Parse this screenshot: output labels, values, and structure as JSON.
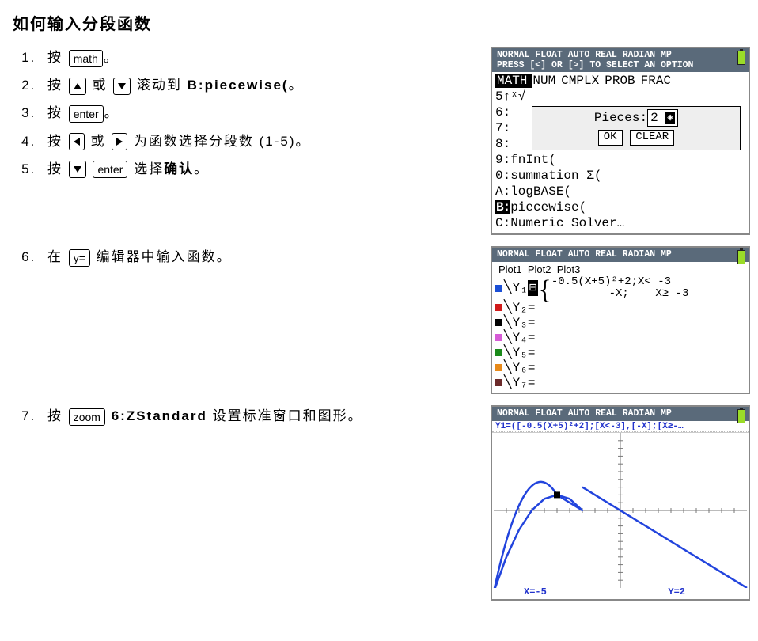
{
  "title": "如何输入分段函数",
  "keys": {
    "math": "math",
    "enter": "enter",
    "yequals": "y=",
    "zoom": "zoom"
  },
  "steps": {
    "s1a": "按 ",
    "s1b": "。",
    "s2a": "按 ",
    "s2b": " 或 ",
    "s2c": " 滚动到 ",
    "s2bold": "B:piecewise(",
    "s2d": "。",
    "s3a": "按 ",
    "s3b": "。",
    "s4a": "按 ",
    "s4b": " 或 ",
    "s4c": " 为函数选择分段数 (1-5)。",
    "s5a": "按 ",
    "s5b": " ",
    "s5c": " 选择",
    "s5bold": "确认",
    "s5d": "。",
    "s6a": "在 ",
    "s6b": " 编辑器中输入函数。",
    "s7a": "按 ",
    "s7b": " ",
    "s7bold": "6:ZStandard",
    "s7c": " 设置标准窗口和图形。"
  },
  "screen1": {
    "hdr1": "NORMAL FLOAT AUTO REAL RADIAN MP",
    "hdr2": "PRESS [<] OR [>] TO SELECT AN OPTION",
    "tabs": {
      "sel": "MATH",
      "t2": "NUM",
      "t3": "CMPLX",
      "t4": "PROB",
      "t5": "FRAC"
    },
    "l5": "5↑ˣ√",
    "l6": "6:",
    "l7": "7:",
    "l8": "8:",
    "popup_label": "Pieces:",
    "popup_val": "2",
    "ok": "OK",
    "clear": "CLEAR",
    "l9": "9:fnInt(",
    "l0": "0:summation Σ(",
    "lA": "A:logBASE(",
    "lB_pre": "B:",
    "lB_txt": "piecewise(",
    "lC": "C:Numeric Solver…"
  },
  "screen2": {
    "hdr1": "NORMAL FLOAT AUTO REAL RADIAN MP",
    "plots": {
      "p1": "Plot1",
      "p2": "Plot2",
      "p3": "Plot3"
    },
    "y1label": "Y₁",
    "piece1a": "-0.5(X+5)²+2;",
    "piece1b": "X< -3",
    "piece2a": "-X;",
    "piece2b": "X≥ -3",
    "yn": {
      "y2": "Y₂=",
      "y3": "Y₃=",
      "y4": "Y₄=",
      "y5": "Y₅=",
      "y6": "Y₆=",
      "y7": "Y₇="
    },
    "colors": {
      "y1": "#1b4fd6",
      "y2": "#d01a1a",
      "y3": "#000000",
      "y4": "#d65bd6",
      "y5": "#1a8a1a",
      "y6": "#e88a1a",
      "y7": "#6b2a2a"
    }
  },
  "screen3": {
    "hdr1": "NORMAL FLOAT AUTO REAL RADIAN MP",
    "expr": "Y1=([-0.5(X+5)²+2];[X<-3],[-X];[X≥-…",
    "status_x": "X=-5",
    "status_y": "Y=2"
  },
  "chart_data": {
    "type": "line",
    "title": "Piecewise function graph",
    "xlabel": "",
    "ylabel": "",
    "xlim": [
      -10,
      10
    ],
    "ylim": [
      -10,
      10
    ],
    "series": [
      {
        "name": "piece1: -0.5(x+5)^2+2 for x<-3",
        "x": [
          -10,
          -9,
          -8,
          -7,
          -6,
          -5,
          -4,
          -3.01
        ],
        "values": [
          -10.5,
          -6,
          -2.5,
          0,
          1.5,
          2,
          1.5,
          0.02
        ]
      },
      {
        "name": "piece2: -x for x>=-3",
        "x": [
          -3,
          -2,
          -1,
          0,
          1,
          2,
          4,
          6,
          8,
          10
        ],
        "values": [
          3,
          2,
          1,
          0,
          -1,
          -2,
          -4,
          -6,
          -8,
          -10
        ]
      }
    ],
    "trace_point": {
      "x": -5,
      "y": 2
    }
  }
}
